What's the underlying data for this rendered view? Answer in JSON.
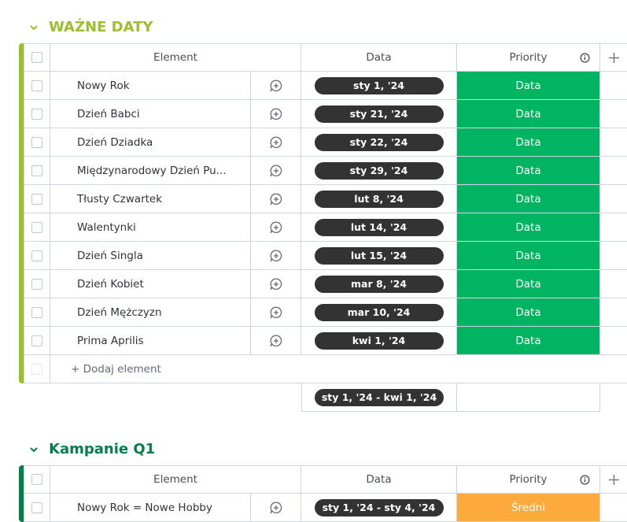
{
  "groups": [
    {
      "title": "WAŻNE DATY",
      "color": "#9cbf2b",
      "columns": {
        "name": "Element",
        "date": "Data",
        "priority": "Priority"
      },
      "rows": [
        {
          "name": "Nowy Rok",
          "date": "sty 1, '24",
          "priority": "Data"
        },
        {
          "name": "Dzień Babci",
          "date": "sty 21, '24",
          "priority": "Data"
        },
        {
          "name": "Dzień Dziadka",
          "date": "sty 22, '24",
          "priority": "Data"
        },
        {
          "name": "Międzynarodowy Dzień Pu...",
          "date": "sty 29, '24",
          "priority": "Data"
        },
        {
          "name": "Tłusty Czwartek",
          "date": "lut 8, '24",
          "priority": "Data"
        },
        {
          "name": "Walentynki",
          "date": "lut 14, '24",
          "priority": "Data"
        },
        {
          "name": "Dzień Singla",
          "date": "lut 15, '24",
          "priority": "Data"
        },
        {
          "name": "Dzień Kobiet",
          "date": "mar 8, '24",
          "priority": "Data"
        },
        {
          "name": "Dzień Mężczyzn",
          "date": "mar 10, '24",
          "priority": "Data"
        },
        {
          "name": "Prima Aprilis",
          "date": "kwi 1, '24",
          "priority": "Data"
        }
      ],
      "priority_color": "#00b461",
      "add_label": "+ Dodaj element",
      "summary_date": "sty 1, '24 - kwi 1, '24"
    },
    {
      "title": "Kampanie Q1",
      "color": "#037f4c",
      "columns": {
        "name": "Element",
        "date": "Data",
        "priority": "Priority"
      },
      "rows": [
        {
          "name": "Nowy Rok = Nowe Hobby",
          "date": "sty 1, '24 - sty 4, '24",
          "priority": "Średni"
        }
      ],
      "priority_color": "#fdab3d"
    }
  ],
  "icons": {
    "collapse": "chevron-down-icon",
    "update": "add-update-icon",
    "info": "info-icon",
    "add_column": "plus-icon"
  }
}
